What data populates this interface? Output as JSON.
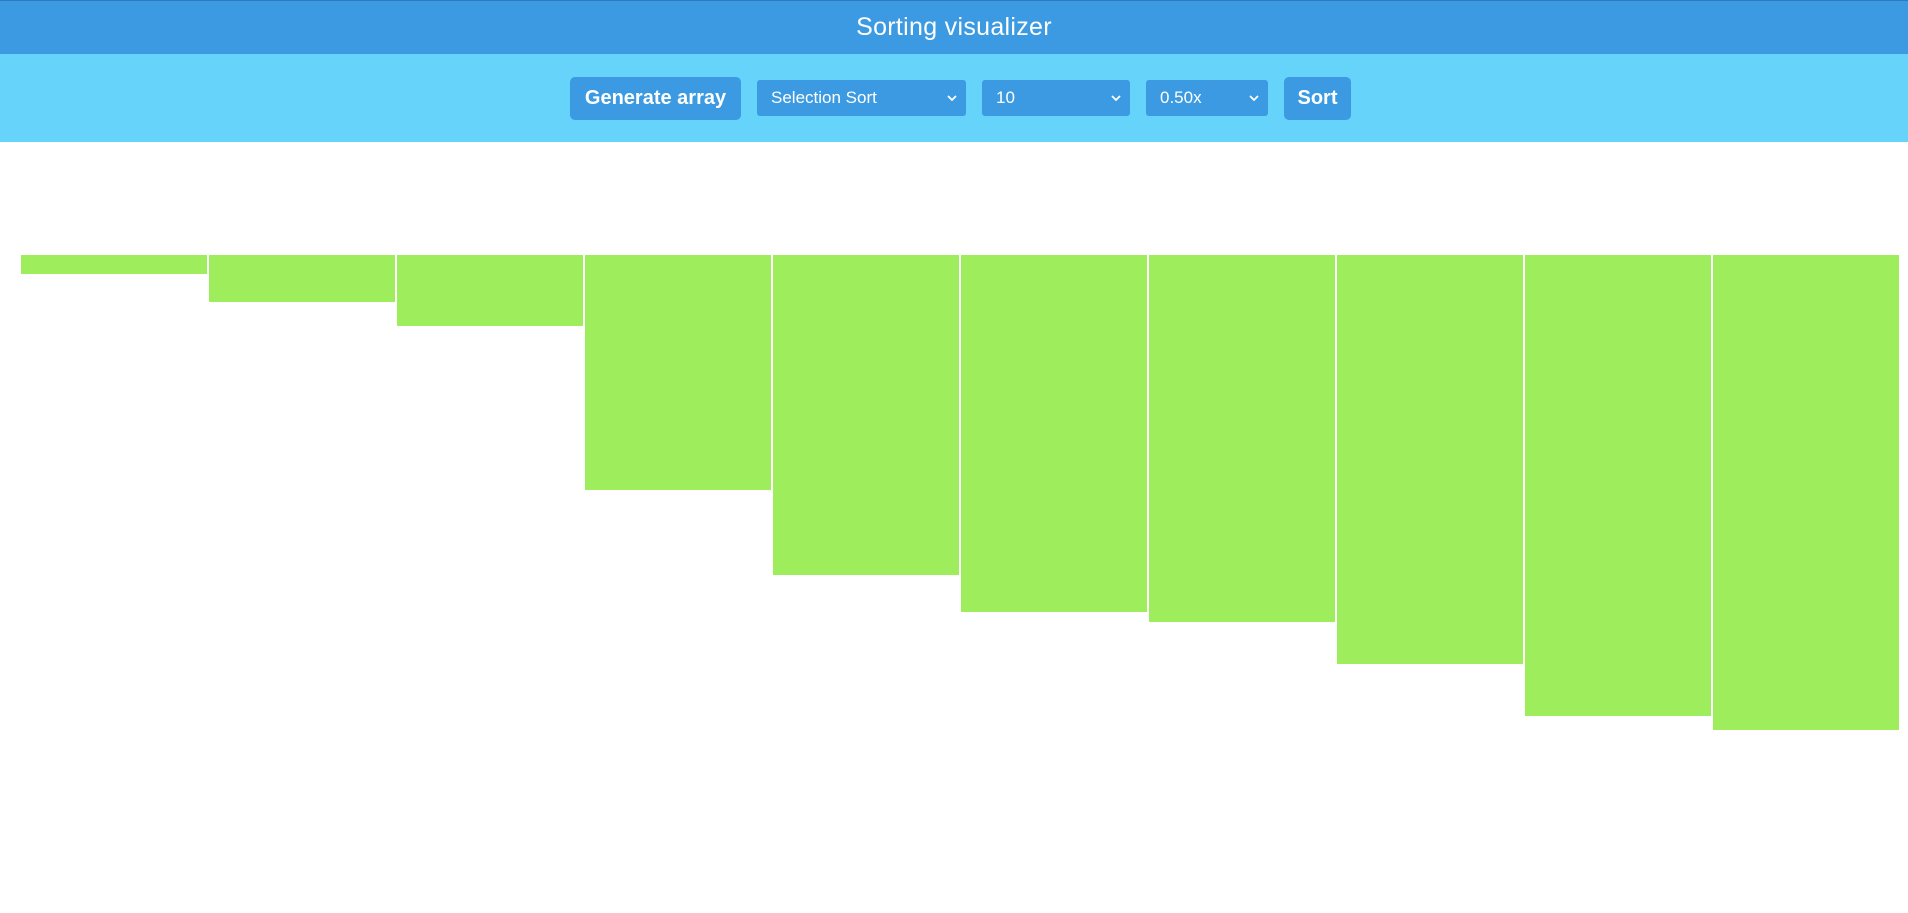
{
  "app": {
    "title": "Sorting visualizer"
  },
  "toolbar": {
    "generate_label": "Generate array",
    "algorithm": {
      "selected": "Selection Sort"
    },
    "size": {
      "selected": "10"
    },
    "speed": {
      "selected": "0.50x"
    },
    "sort_label": "Sort"
  },
  "colors": {
    "title_bar": "#3b9ae1",
    "toolbar": "#66d3fa",
    "control": "#3b9ae1",
    "bar": "#9eed5d"
  },
  "array": {
    "values": [
      2,
      5,
      7.5,
      25,
      34,
      38,
      39,
      43.5,
      49,
      50.5
    ],
    "max": 50.5
  }
}
